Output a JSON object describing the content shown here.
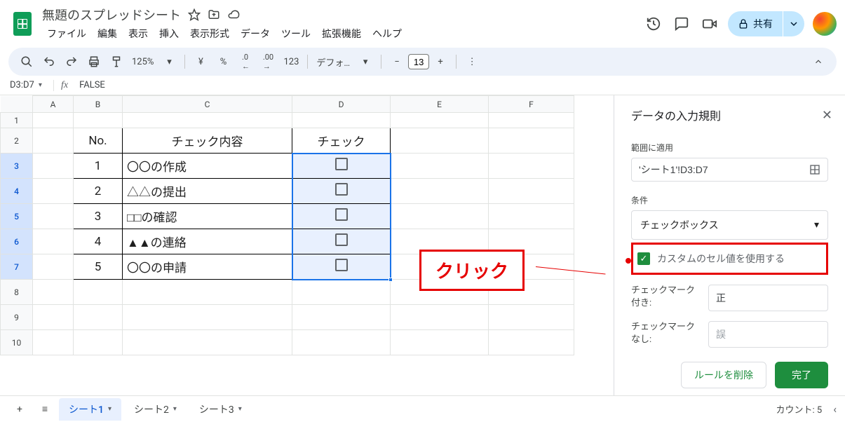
{
  "doc_title": "無題のスプレッドシート",
  "menubar": [
    "ファイル",
    "編集",
    "表示",
    "挿入",
    "表示形式",
    "データ",
    "ツール",
    "拡張機能",
    "ヘルプ"
  ],
  "share_label": "共有",
  "toolbar": {
    "zoom": "125%",
    "currency": "¥",
    "percent": "%",
    "dec_dec": ".0",
    "inc_dec": ".00",
    "num_123": "123",
    "font": "デフォ…",
    "font_size": "13"
  },
  "name_box": "D3:D7",
  "fx_label": "fx",
  "formula": "FALSE",
  "columns": [
    "A",
    "B",
    "C",
    "D",
    "E",
    "F"
  ],
  "rows": [
    1,
    2,
    3,
    4,
    5,
    6,
    7,
    8,
    9,
    10
  ],
  "table": {
    "headers": {
      "no": "No.",
      "content": "チェック内容",
      "check": "チェック"
    },
    "rows": [
      {
        "no": "1",
        "content": "〇〇の作成"
      },
      {
        "no": "2",
        "content": "△△の提出"
      },
      {
        "no": "3",
        "content": "□□の確認"
      },
      {
        "no": "4",
        "content": "▲▲の連絡"
      },
      {
        "no": "5",
        "content": "〇〇の申請"
      }
    ]
  },
  "callout": "クリック",
  "sidepanel": {
    "title": "データの入力規則",
    "range_label": "範囲に適用",
    "range_value": "'シート1'!D3:D7",
    "condition_label": "条件",
    "condition_value": "チェックボックス",
    "custom_checkbox_label": "カスタムのセル値を使用する",
    "checked_label": "チェックマーク付き:",
    "checked_value": "正",
    "unchecked_label": "チェックマークなし:",
    "unchecked_placeholder": "誤",
    "delete_rule": "ルールを削除",
    "done": "完了"
  },
  "tabs": [
    "シート1",
    "シート2",
    "シート3"
  ],
  "status_count": "カウント: 5"
}
